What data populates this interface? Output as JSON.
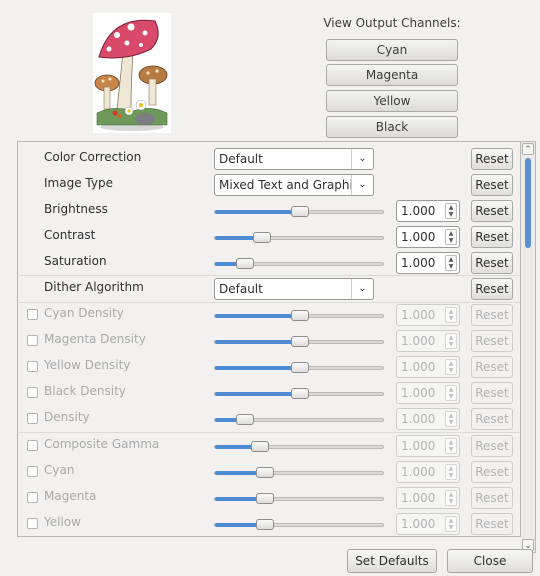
{
  "channels": {
    "title": "View Output Channels:",
    "buttons": [
      "Cyan",
      "Magenta",
      "Yellow",
      "Black"
    ]
  },
  "rows": [
    {
      "label": "Color Correction",
      "kind": "combo",
      "value": "Default",
      "reset": "Reset"
    },
    {
      "label": "Image Type",
      "kind": "combo",
      "value": "Mixed Text and Graphi",
      "reset": "Reset"
    },
    {
      "label": "Brightness",
      "kind": "slider",
      "value": "1.000",
      "level": 0.5,
      "reset": "Reset"
    },
    {
      "label": "Contrast",
      "kind": "slider",
      "value": "1.000",
      "level": 0.25,
      "reset": "Reset"
    },
    {
      "label": "Saturation",
      "kind": "slider",
      "value": "1.000",
      "level": 0.14,
      "reset": "Reset"
    },
    {
      "label": "Dither Algorithm",
      "kind": "combo",
      "value": "Default",
      "reset": "Reset"
    },
    {
      "label": "Cyan Density",
      "kind": "slider",
      "value": "1.000",
      "level": 0.5,
      "reset": "Reset",
      "disabled": true
    },
    {
      "label": "Magenta Density",
      "kind": "slider",
      "value": "1.000",
      "level": 0.5,
      "reset": "Reset",
      "disabled": true
    },
    {
      "label": "Yellow Density",
      "kind": "slider",
      "value": "1.000",
      "level": 0.5,
      "reset": "Reset",
      "disabled": true
    },
    {
      "label": "Black Density",
      "kind": "slider",
      "value": "1.000",
      "level": 0.5,
      "reset": "Reset",
      "disabled": true
    },
    {
      "label": "Density",
      "kind": "slider",
      "value": "1.000",
      "level": 0.14,
      "reset": "Reset",
      "disabled": true
    },
    {
      "label": "Composite Gamma",
      "kind": "slider",
      "value": "1.000",
      "level": 0.24,
      "reset": "Reset",
      "disabled": true
    },
    {
      "label": "Cyan",
      "kind": "slider",
      "value": "1.000",
      "level": 0.27,
      "reset": "Reset",
      "disabled": true
    },
    {
      "label": "Magenta",
      "kind": "slider",
      "value": "1.000",
      "level": 0.27,
      "reset": "Reset",
      "disabled": true
    },
    {
      "label": "Yellow",
      "kind": "slider",
      "value": "1.000",
      "level": 0.27,
      "reset": "Reset",
      "disabled": true
    }
  ],
  "footer": {
    "set_defaults": "Set Defaults",
    "close": "Close"
  },
  "colors": {
    "accent": "#4d8bd3",
    "background": "#f2f1f0"
  }
}
